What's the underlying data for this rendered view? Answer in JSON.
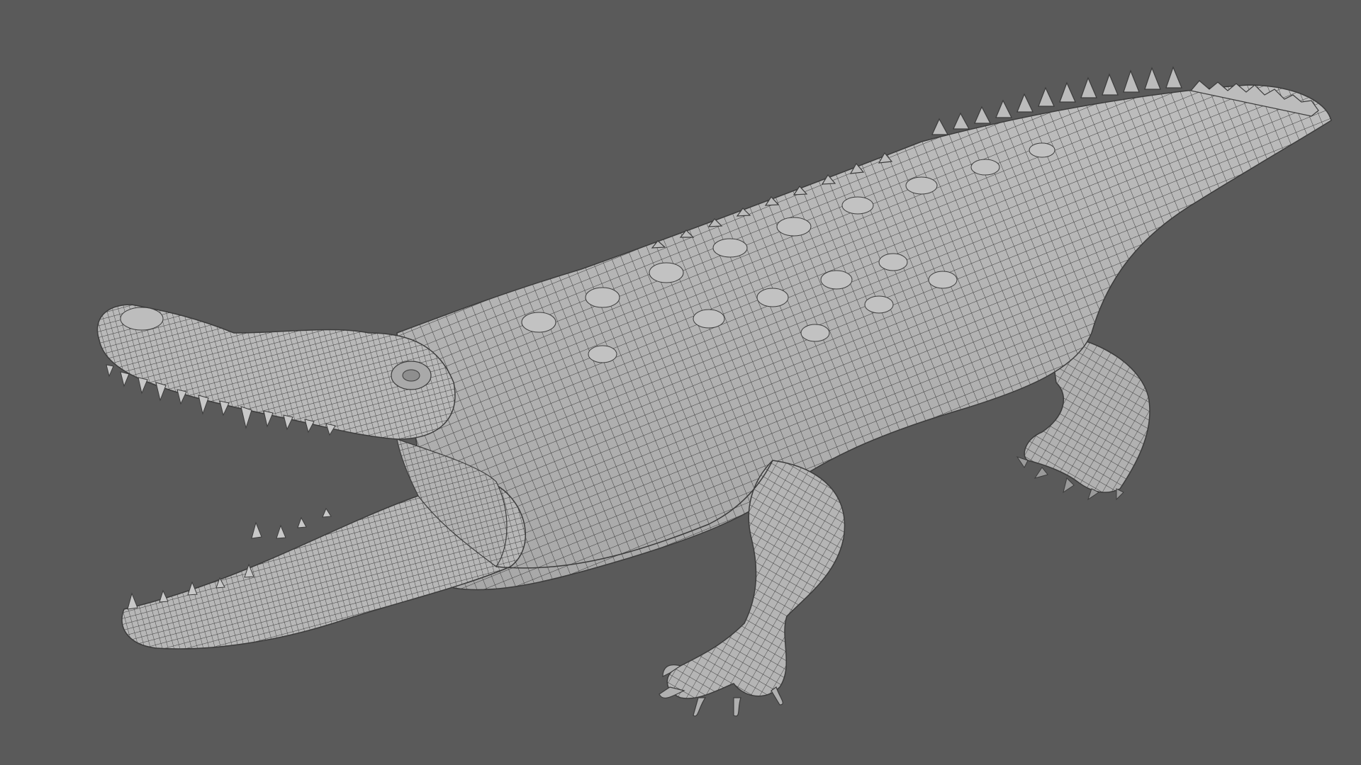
{
  "viewport": {
    "background": "#5a5a5a",
    "mesh_fill": "#b4b4b4",
    "wire_color": "#3c3c3c",
    "shade_color": "#8e8e8e"
  },
  "model": {
    "subject": "crocodile",
    "display": "wireframe-on-shaded",
    "mouth": "open"
  }
}
